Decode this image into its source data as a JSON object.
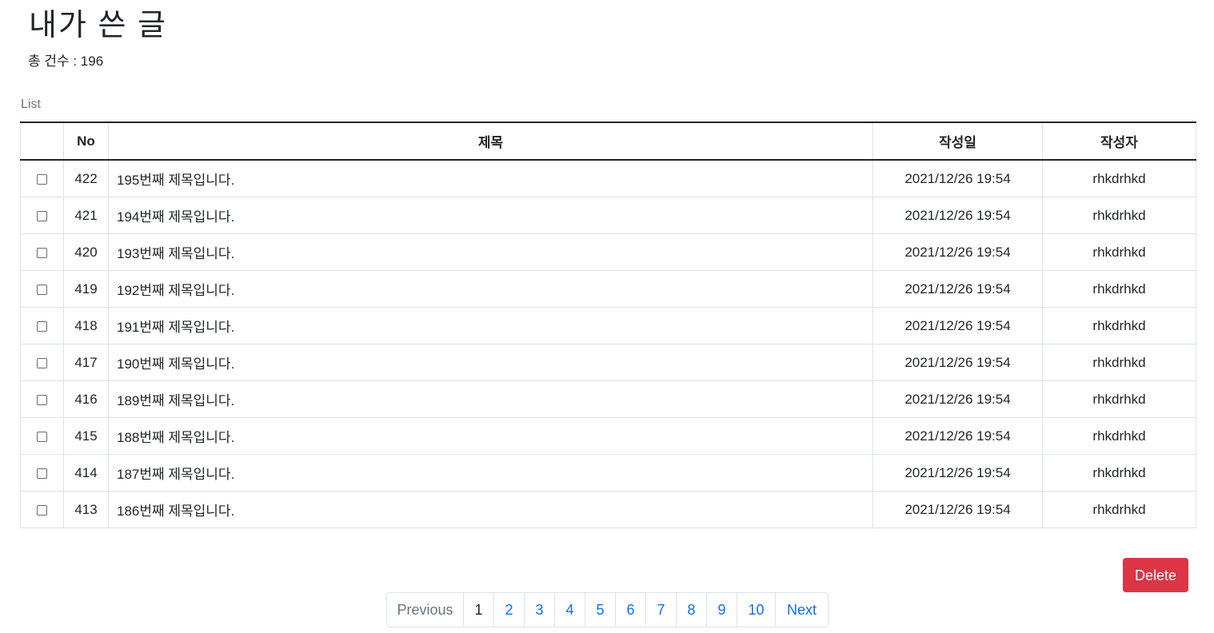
{
  "header": {
    "title": "내가 쓴 글",
    "total_label": "총 건수 : 196"
  },
  "table": {
    "caption": "List",
    "columns": [
      "",
      "No",
      "제목",
      "작성일",
      "작성자"
    ],
    "rows": [
      {
        "no": "422",
        "title": "195번째 제목입니다.",
        "date": "2021/12/26 19:54",
        "author": "rhkdrhkd"
      },
      {
        "no": "421",
        "title": "194번째 제목입니다.",
        "date": "2021/12/26 19:54",
        "author": "rhkdrhkd"
      },
      {
        "no": "420",
        "title": "193번째 제목입니다.",
        "date": "2021/12/26 19:54",
        "author": "rhkdrhkd"
      },
      {
        "no": "419",
        "title": "192번째 제목입니다.",
        "date": "2021/12/26 19:54",
        "author": "rhkdrhkd"
      },
      {
        "no": "418",
        "title": "191번째 제목입니다.",
        "date": "2021/12/26 19:54",
        "author": "rhkdrhkd"
      },
      {
        "no": "417",
        "title": "190번째 제목입니다.",
        "date": "2021/12/26 19:54",
        "author": "rhkdrhkd"
      },
      {
        "no": "416",
        "title": "189번째 제목입니다.",
        "date": "2021/12/26 19:54",
        "author": "rhkdrhkd"
      },
      {
        "no": "415",
        "title": "188번째 제목입니다.",
        "date": "2021/12/26 19:54",
        "author": "rhkdrhkd"
      },
      {
        "no": "414",
        "title": "187번째 제목입니다.",
        "date": "2021/12/26 19:54",
        "author": "rhkdrhkd"
      },
      {
        "no": "413",
        "title": "186번째 제목입니다.",
        "date": "2021/12/26 19:54",
        "author": "rhkdrhkd"
      }
    ]
  },
  "actions": {
    "delete_label": "Delete"
  },
  "pagination": {
    "previous_label": "Previous",
    "pages": [
      "1",
      "2",
      "3",
      "4",
      "5",
      "6",
      "7",
      "8",
      "9",
      "10"
    ],
    "current_page": "1",
    "next_label": "Next"
  },
  "colors": {
    "link": "#0d6efd",
    "danger": "#dc3545",
    "muted": "#6c757d"
  }
}
